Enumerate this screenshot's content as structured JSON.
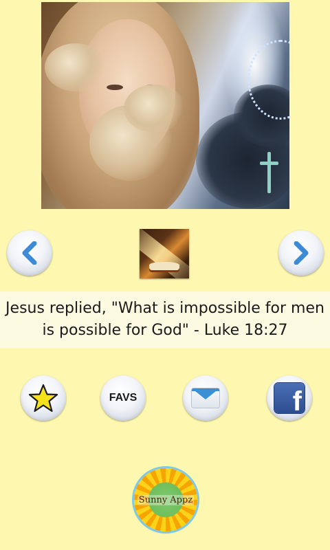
{
  "hero": {
    "image": "virgin-mary-with-clouds-and-cross"
  },
  "navigation": {
    "prev_icon": "chevron-left-icon",
    "next_icon": "chevron-right-icon",
    "book_icon": "open-bible-with-light-ray",
    "accent_color": "#3d8ad6"
  },
  "quote": {
    "text": "Jesus replied, \"What is impossible for men is possible for God\" - Luke 18:27"
  },
  "actions": {
    "favorite_icon": "star-icon",
    "favs_label": "FAVS",
    "share_email_icon": "envelope-icon",
    "facebook_icon": "facebook-icon"
  },
  "branding": {
    "logo_text": "Sunny Appz"
  },
  "colors": {
    "background": "#fdf7b0",
    "quote_background": "#fdfae2",
    "star_fill": "#f5e21a"
  }
}
